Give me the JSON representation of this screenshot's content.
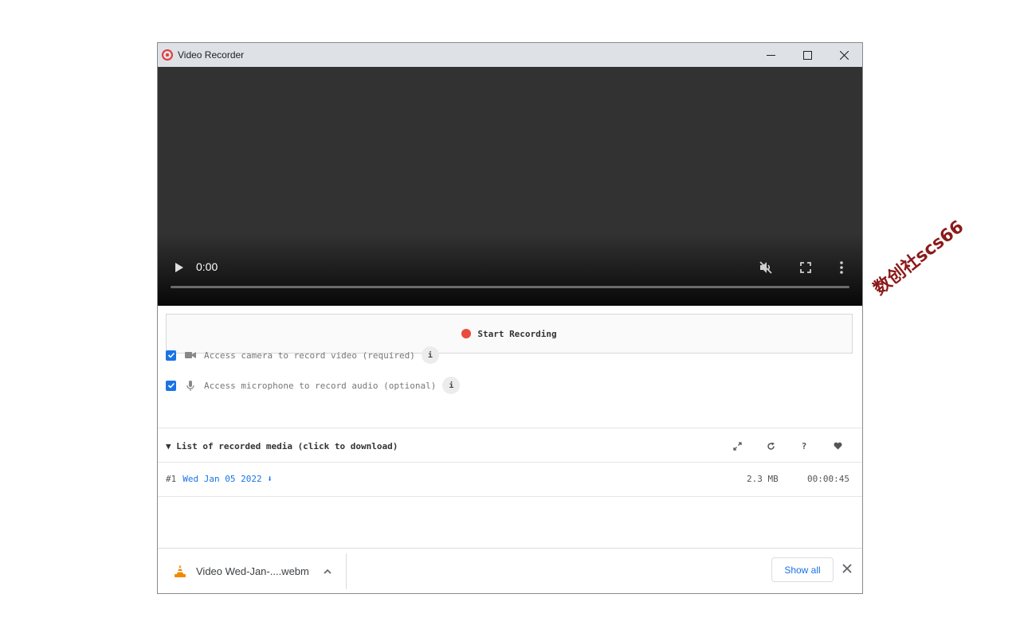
{
  "window": {
    "title": "Video Recorder"
  },
  "video": {
    "time": "0:00",
    "progress": 0
  },
  "recorder": {
    "start_label": "Start Recording",
    "options": [
      {
        "label": "Access camera to record video (required)",
        "checked": true
      },
      {
        "label": "Access microphone to record audio (optional)",
        "checked": true
      }
    ],
    "info_label": "i"
  },
  "media_list": {
    "header": "▼ List of recorded media (click to download)",
    "tools": {
      "help": "?"
    },
    "rows": [
      {
        "num": "#1",
        "date": "Wed Jan 05 2022 ⬇",
        "size": "2.3 MB",
        "duration": "00:00:45"
      }
    ]
  },
  "download_bar": {
    "file_name": "Video Wed-Jan-....webm",
    "show_all": "Show all"
  },
  "watermark": "数创社scs66",
  "colors": {
    "titlebar": "#dee1e6",
    "video_bg": "#323232",
    "record_dot": "#e74c3c",
    "link": "#1a73e8"
  }
}
